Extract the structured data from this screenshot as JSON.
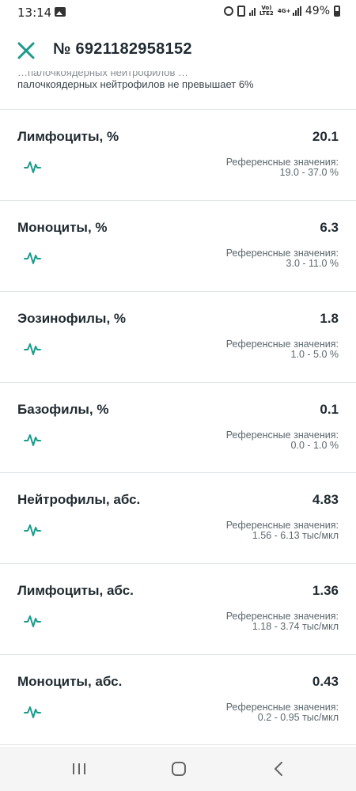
{
  "status_bar": {
    "time": "13:14",
    "network_label": "Vo) LTE2",
    "network_type": "4G+",
    "battery": "49%"
  },
  "header": {
    "title": "№ 6921182958152"
  },
  "partial_note": {
    "line1": "…палочкоядерных нейтрофилов …",
    "line2": "палочкоядерных нейтрофилов не превышает 6%"
  },
  "results": [
    {
      "name": "Лимфоциты, %",
      "value": "20.1",
      "ref_label": "Референсные значения:",
      "ref_range": "19.0 - 37.0 %"
    },
    {
      "name": "Моноциты, %",
      "value": "6.3",
      "ref_label": "Референсные значения:",
      "ref_range": "3.0 - 11.0 %"
    },
    {
      "name": "Эозинофилы, %",
      "value": "1.8",
      "ref_label": "Референсные значения:",
      "ref_range": "1.0 - 5.0 %"
    },
    {
      "name": "Базофилы, %",
      "value": "0.1",
      "ref_label": "Референсные значения:",
      "ref_range": "0.0 - 1.0 %"
    },
    {
      "name": "Нейтрофилы, абс.",
      "value": "4.83",
      "ref_label": "Референсные значения:",
      "ref_range": "1.56 - 6.13 тыс/мкл"
    },
    {
      "name": "Лимфоциты, абс.",
      "value": "1.36",
      "ref_label": "Референсные значения:",
      "ref_range": "1.18 - 3.74 тыс/мкл"
    },
    {
      "name": "Моноциты, абс.",
      "value": "0.43",
      "ref_label": "Референсные значения:",
      "ref_range": "0.2 - 0.95 тыс/мкл"
    }
  ],
  "colors": {
    "accent": "#1a9a8a",
    "text": "#1f2a30",
    "muted": "#5c686e",
    "divider": "#e2e5e7"
  },
  "icons": {
    "close": "close-icon",
    "chart": "chart-icon"
  }
}
